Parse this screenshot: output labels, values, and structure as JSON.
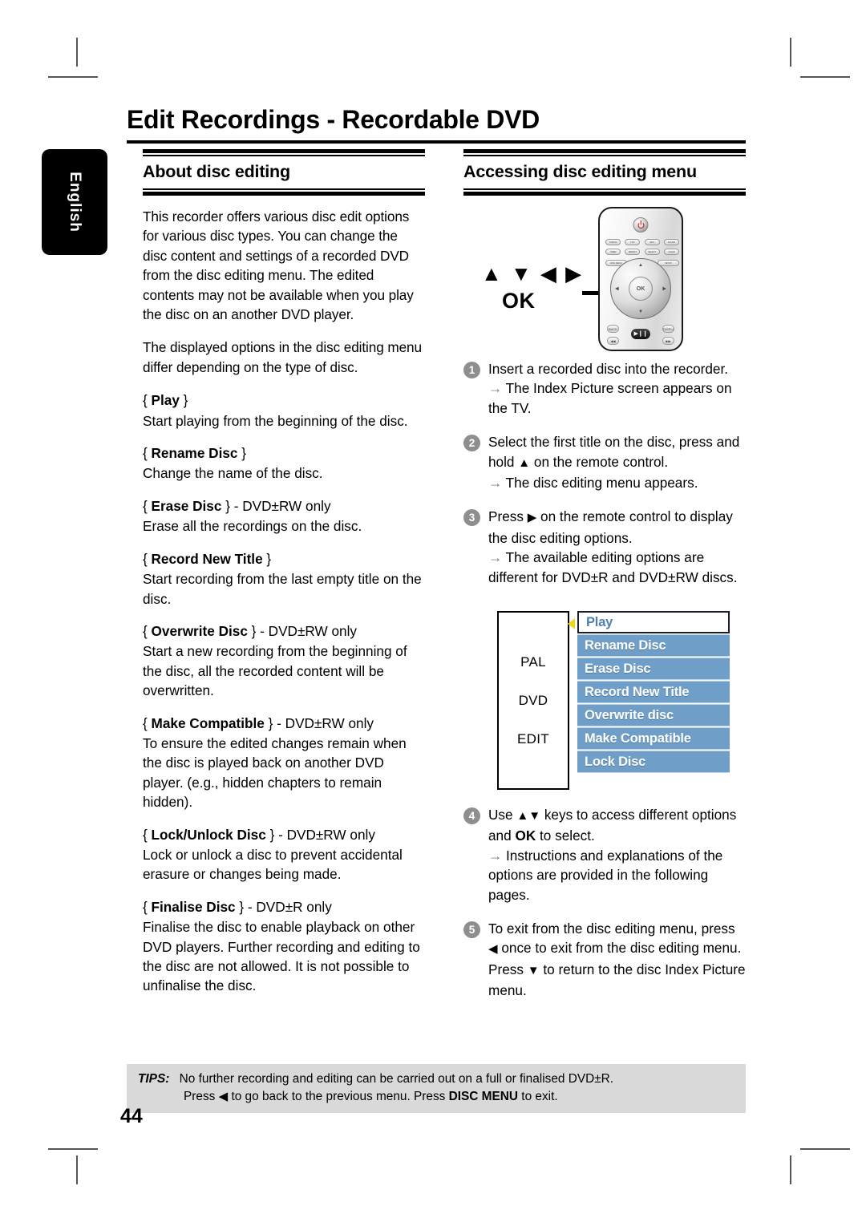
{
  "page": {
    "chapter_title": "Edit Recordings - Recordable DVD",
    "language_tab": "English",
    "page_number": "44"
  },
  "left_column": {
    "section_title": "About disc editing",
    "intro_paragraphs": [
      "This recorder offers various disc edit options for various disc types. You can change the disc content and settings of a recorded DVD from the disc editing menu. The edited contents may not be available when you play the disc on an another DVD player.",
      "The displayed options in the disc editing menu differ depending on the type of disc."
    ],
    "options": [
      {
        "open_brace": "{",
        "name": "Play",
        "close_brace": "}",
        "suffix": "",
        "description": "Start playing from the beginning of the disc."
      },
      {
        "open_brace": "{",
        "name": "Rename Disc",
        "close_brace": "}",
        "suffix": "",
        "description": "Change the name of the disc."
      },
      {
        "open_brace": "{",
        "name": "Erase Disc",
        "close_brace": "}",
        "suffix": " - DVD±RW only",
        "description": "Erase all the recordings on the disc."
      },
      {
        "open_brace": "{",
        "name": "Record New Title",
        "close_brace": "}",
        "suffix": "",
        "description": "Start recording from the last empty title on the disc."
      },
      {
        "open_brace": "{",
        "name": "Overwrite Disc",
        "close_brace": "}",
        "suffix": " - DVD±RW only",
        "description": "Start a new recording from the beginning of the disc, all the recorded content will be overwritten."
      },
      {
        "open_brace": "{",
        "name": "Make Compatible",
        "close_brace": "}",
        "suffix": " - DVD±RW only",
        "description": "To ensure the edited changes remain when the disc is played back on another DVD player. (e.g., hidden chapters to remain hidden)."
      },
      {
        "open_brace": "{",
        "name": "Lock/Unlock Disc",
        "close_brace": "}",
        "suffix": " - DVD±RW only",
        "description": "Lock or unlock a disc to prevent accidental erasure or changes being made."
      },
      {
        "open_brace": "{",
        "name": "Finalise Disc",
        "close_brace": "}",
        "suffix": " - DVD±R only",
        "description": "Finalise the disc to enable playback on other DVD players. Further recording and editing to the disc are not allowed. It is not possible to unfinalise the disc."
      }
    ]
  },
  "right_column": {
    "section_title": "Accessing disc editing menu",
    "remote_illustration": {
      "key_labels": "▲ ▼ ◀ ▶",
      "ok_label": "OK",
      "ok_button_text": "OK",
      "remote_buttons_row1": [
        "TV/DISC",
        "TOP",
        "INFO",
        "SOUND"
      ],
      "remote_buttons_row2": [
        "TIMER",
        "REPEAT",
        "SELECT",
        "CLEAR"
      ],
      "remote_buttons_row3": [
        "DISC MENU",
        "SETUP"
      ],
      "remote_buttons_row4": [
        "BACK",
        "DISPLAY"
      ],
      "playpause_label": "▶❙❙"
    },
    "steps": [
      {
        "num": "1",
        "text": "Insert a recorded disc into the recorder.",
        "sub": "→ The Index Picture screen appears on the TV."
      },
      {
        "num": "2",
        "text_before": "Select the first title on the disc, press and hold ",
        "key": "▲",
        "text_after": " on the remote control.",
        "sub": "→ The disc editing menu appears."
      },
      {
        "num": "3",
        "text_before": "Press ",
        "key": "▶",
        "text_after": " on the remote control to display the disc editing options.",
        "sub": "→ The available editing options are different for DVD±R and DVD±RW discs."
      },
      {
        "num": "4",
        "text_before": "Use ",
        "key": "▲▼",
        "text_mid": " keys to access different options and ",
        "kbd": "OK",
        "text_after": " to select.",
        "sub": "→ Instructions and explanations of the options are provided in the following pages."
      },
      {
        "num": "5",
        "text_before": "To exit from the disc editing menu, press ",
        "key": "◀",
        "text_mid": " once to exit from the disc editing menu.  Press ",
        "key2": "▼",
        "text_after": " to return to the disc Index Picture menu."
      }
    ],
    "osd": {
      "left_labels": [
        "PAL",
        "DVD",
        "EDIT"
      ],
      "menu_items": [
        {
          "label": "Play",
          "selected": true
        },
        {
          "label": "Rename Disc",
          "selected": false
        },
        {
          "label": "Erase Disc",
          "selected": false
        },
        {
          "label": "Record New Title",
          "selected": false
        },
        {
          "label": "Overwrite disc",
          "selected": false
        },
        {
          "label": "Make Compatible",
          "selected": false
        },
        {
          "label": "Lock Disc",
          "selected": false
        }
      ],
      "colors": {
        "item_blue": "#6f9fc9",
        "item_border": "#bcd6ea",
        "selected_text": "#4f7fae",
        "cursor_arrow": "#f2d51a"
      }
    }
  },
  "tips": {
    "label": "TIPS:",
    "line1": "No further recording and editing can be carried out on a full or finalised DVD±R.",
    "line2_before": "Press ",
    "line2_key": "◀",
    "line2_mid": " to go back to the previous menu. Press ",
    "line2_kbd": "DISC MENU",
    "line2_after": " to exit."
  }
}
